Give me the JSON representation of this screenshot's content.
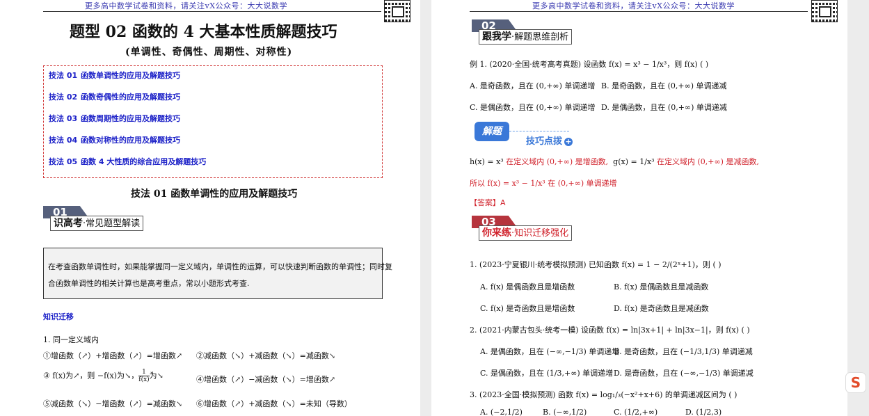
{
  "header_text": "更多高中数学试卷和资料，请关注vX公众号：大大说数学",
  "left": {
    "title": "题型 02  函数的 4 大基本性质解题技巧",
    "subtitle": "(单调性、奇偶性、周期性、对称性)",
    "toc": [
      {
        "num": "技法 01",
        "text": "函数单调性的应用及解题技巧"
      },
      {
        "num": "技法 02",
        "text": "函数奇偶性的应用及解题技巧"
      },
      {
        "num": "技法 03",
        "text": "函数周期性的应用及解题技巧"
      },
      {
        "num": "技法 04",
        "text": "函数对称性的应用及解题技巧"
      },
      {
        "num": "技法 05",
        "text": "函数 4 大性质的综合应用及解题技巧"
      }
    ],
    "section_title": "技法 01  函数单调性的应用及解题技巧",
    "badge1": {
      "num": "01",
      "bold": "识高考",
      "rest": "·常见题型解读"
    },
    "box_text_1": "在考查函数单调性时，如果能掌握同一定义域内，单调性的运算，可以快速判断函数的单调性；同时复",
    "box_text_2": "合函数单调性的相关计算也是高考重点，常以小题形式考查.",
    "knowledge_title": "知识迁移",
    "item1": "1. 同一定义域内",
    "row1_a": "①增函数（↗）+增函数（↗）=增函数↗",
    "row1_b": "②减函数（↘）+减函数（↘）=减函数↘",
    "row2_a": "③ f(x)为↗，则 −f(x)为↘，",
    "row2_frac_num": "1",
    "row2_frac_den": "f(x)",
    "row2_a_end": "为↘",
    "row2_b": "④增函数（↗）−减函数（↘）=增函数↗",
    "row3_a": "⑤减函数（↘）−增函数（↗）=减函数↘",
    "row3_b": "⑥增函数（↗）+减函数（↘）=未知（导数）"
  },
  "right": {
    "badge2": {
      "num": "02",
      "bold": "跟我学",
      "rest": "·解题思维剖析"
    },
    "ex1": "例 1.  (2020·全国·统考高考真题) 设函数 f(x) = x³ − 1/x³，则 f(x)  (   )",
    "ex1_A": "A.  是奇函数，且在 (0,+∞) 单调递增",
    "ex1_B": "B.  是奇函数，且在 (0,+∞) 单调递减",
    "ex1_C": "C.  是偶函数，且在 (0,+∞) 单调递增",
    "ex1_D": "D.  是偶函数，且在 (0,+∞) 单调递减",
    "jieti": "解题",
    "jiqiao": "技巧点拨",
    "sol1_a": "h(x) = x³",
    "sol1_b": "在定义域内 (0,+∞) 是增函数,",
    "sol1_c": "g(x) = 1/x³",
    "sol1_d": "在定义域内 (0,+∞) 是减函数,",
    "sol2_a": "所以 f(x) = x³ − 1/x³",
    "sol2_b": "在 (0,+∞) 单调递增",
    "answer": "【答案】A",
    "badge3": {
      "num": "03",
      "bold": "你来练",
      "rest": "·知识迁移强化"
    },
    "q1": "1.   (2023·宁夏银川·统考模拟预测) 已知函数 f(x) = 1 − 2/(2ˣ+1)，则  (   )",
    "q1_A": "A.   f(x) 是偶函数且是增函数",
    "q1_B": "B.   f(x) 是偶函数且是减函数",
    "q1_C": "C.   f(x) 是奇函数且是增函数",
    "q1_D": "D.   f(x) 是奇函数且是减函数",
    "q2": "2.   (2021·内蒙古包头·统考一模) 设函数 f(x) = ln|3x+1| + ln|3x−1|，则 f(x)  (   )",
    "q2_A": "A.  是偶函数，且在 (−∞,−1/3) 单调递增",
    "q2_B": "B.  是奇函数，且在 (−1/3,1/3) 单调递减",
    "q2_C": "C.  是偶函数，且在 (1/3,+∞) 单调递增",
    "q2_D": "D.  是奇函数，且在 (−∞,−1/3) 单调递减",
    "q3": "3.   (2023·全国·模拟预测) 函数 f(x) = log₁/₃(−x²+x+6) 的单调递减区间为  (   )",
    "q3_A": "A.  (−2,1/2)",
    "q3_B": "B.  (−∞,1/2)",
    "q3_C": "C.  (1/2,+∞)",
    "q3_D": "D.  (1/2,3)"
  },
  "sidebar_icon": "S"
}
